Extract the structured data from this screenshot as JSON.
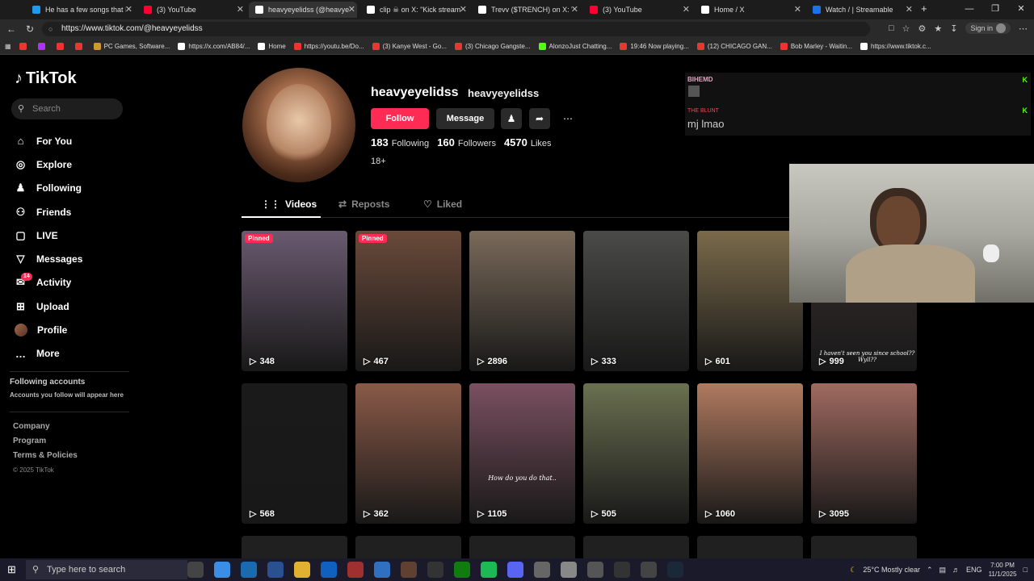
{
  "browser": {
    "tabs": [
      {
        "title": "He has a few songs that I've",
        "color": "#1d9bf0"
      },
      {
        "title": "(3) YouTube",
        "color": "#ff0033"
      },
      {
        "title": "heavyeyelidss (@heavyeyelidss)",
        "color": "#ffffff"
      },
      {
        "title": "clip ☠ on X: \"Kick stream",
        "color": "#ffffff"
      },
      {
        "title": "Trevv ($TRENCH) on X: \"Lo",
        "color": "#ffffff"
      },
      {
        "title": "(3) YouTube",
        "color": "#ff0033"
      },
      {
        "title": "Home / X",
        "color": "#ffffff"
      },
      {
        "title": "Watch / | Streamable",
        "color": "#1a73e8"
      }
    ],
    "url": "https://www.tiktok.com/@heavyeyelidss",
    "sign_in": "Sign in",
    "bookmarks": [
      {
        "label": "",
        "color": "#e33"
      },
      {
        "label": "",
        "color": "#a3f"
      },
      {
        "label": "",
        "color": "#e33"
      },
      {
        "label": "",
        "color": "#e33"
      },
      {
        "label": "PC Games, Software...",
        "color": "#c93"
      },
      {
        "label": "https://x.com/AB84/...",
        "color": "#fff"
      },
      {
        "label": "Home",
        "color": "#fff"
      },
      {
        "label": "https://youtu.be/Do...",
        "color": "#e33"
      },
      {
        "label": "(3) Kanye West - Go...",
        "color": "#e33"
      },
      {
        "label": "(3) Chicago Gangste...",
        "color": "#e33"
      },
      {
        "label": "AlonzoJust Chatting...",
        "color": "#53fc18"
      },
      {
        "label": "19:46 Now playing...",
        "color": "#e33"
      },
      {
        "label": "(12) CHICAGO GAN...",
        "color": "#e33"
      },
      {
        "label": "Bob Marley - Waitin...",
        "color": "#e33"
      },
      {
        "label": "https://www.tiktok.c...",
        "color": "#fff"
      }
    ]
  },
  "tiktok": {
    "logo": "TikTok",
    "search_placeholder": "Search",
    "nav": [
      {
        "label": "For You",
        "icon": "home-icon",
        "glyph": "⌂"
      },
      {
        "label": "Explore",
        "icon": "compass-icon",
        "glyph": "◎"
      },
      {
        "label": "Following",
        "icon": "following-icon",
        "glyph": "♟"
      },
      {
        "label": "Friends",
        "icon": "friends-icon",
        "glyph": "⚇"
      },
      {
        "label": "LIVE",
        "icon": "live-icon",
        "glyph": "▢"
      },
      {
        "label": "Messages",
        "icon": "messages-icon",
        "glyph": "▽"
      },
      {
        "label": "Activity",
        "icon": "activity-icon",
        "glyph": "✉",
        "badge": "14"
      },
      {
        "label": "Upload",
        "icon": "upload-icon",
        "glyph": "⊞"
      },
      {
        "label": "Profile",
        "icon": "profile-avatar",
        "glyph": ""
      },
      {
        "label": "More",
        "icon": "more-icon",
        "glyph": "…"
      }
    ],
    "following_accounts_title": "Following accounts",
    "following_accounts_sub": "Accounts you follow will appear here",
    "footer": [
      "Company",
      "Program",
      "Terms & Policies"
    ],
    "copyright": "© 2025 TikTok"
  },
  "profile": {
    "username": "heavyeyelidss",
    "nickname": "heavyeyelidss",
    "follow_label": "Follow",
    "message_label": "Message",
    "following_count": "183",
    "following_label": "Following",
    "followers_count": "160",
    "followers_label": "Followers",
    "likes_count": "4570",
    "likes_label": "Likes",
    "age_tag": "18+",
    "tabs": [
      "Videos",
      "Reposts",
      "Liked"
    ]
  },
  "videos": [
    {
      "views": "348",
      "pinned": "Pinned",
      "color": "#6a5a70"
    },
    {
      "views": "467",
      "pinned": "Pinned",
      "color": "#6a4a3a"
    },
    {
      "views": "2896",
      "pinned": "",
      "color": "#7a6a5a"
    },
    {
      "views": "333",
      "pinned": "",
      "color": "#4a4a48"
    },
    {
      "views": "601",
      "pinned": "",
      "color": "#7a6a4a"
    },
    {
      "views": "999",
      "pinned": "",
      "color": "#3a3030"
    },
    {
      "views": "568",
      "pinned": "",
      "color": "#1a1a1a"
    },
    {
      "views": "362",
      "pinned": "",
      "color": "#8a5a48"
    },
    {
      "views": "1105",
      "pinned": "",
      "color": "#7a5060"
    },
    {
      "views": "505",
      "pinned": "",
      "color": "#6a7050"
    },
    {
      "views": "1060",
      "pinned": "",
      "color": "#b07a60"
    },
    {
      "views": "3095",
      "pinned": "",
      "color": "#a06a60"
    }
  ],
  "overlay": {
    "chat_user1": "BIHEMD",
    "chat_user2": "THE BLUNT",
    "chat_message": "mj lmao",
    "video_caption": "I haven't seen you since school?? Wyll??",
    "video_caption2": "How do you do that.."
  },
  "taskbar": {
    "search_placeholder": "Type here to search",
    "weather": "25°C  Mostly clear",
    "lang": "ENG",
    "time": "7:00 PM",
    "date": "11/1/2025"
  },
  "colors": {
    "accent": "#fe2c55",
    "kick": "#53fc18"
  }
}
